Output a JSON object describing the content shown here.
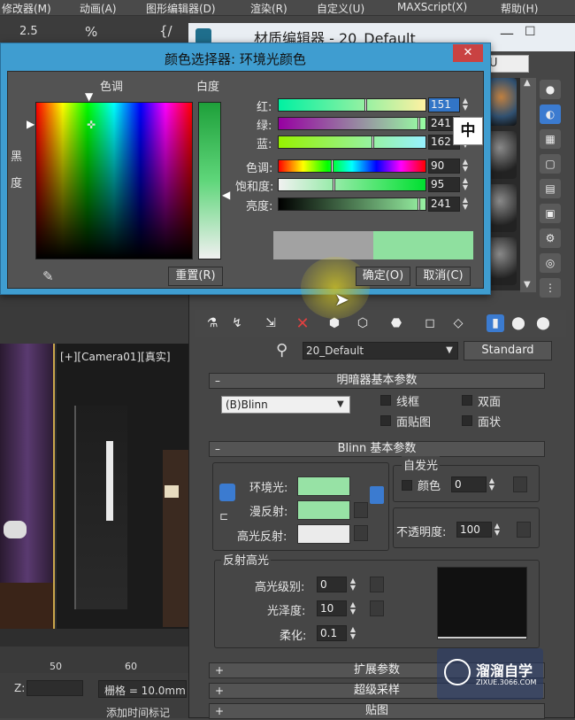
{
  "menubar": {
    "items": [
      "修改器(M)",
      "动画(A)",
      "图形编辑器(D)",
      "渲染(R)",
      "自定义(U)",
      "MAXScript(X)",
      "帮助(H)"
    ]
  },
  "left_toolbar": {
    "snap_value": "2.5",
    "percent": "%"
  },
  "viewport": {
    "camera_label": "[+][Camera01][真实]",
    "ruler_ticks": [
      "50",
      "60"
    ],
    "z_label": "Z:",
    "grid_label": "栅格 = 10.0mm",
    "add_time_tag": "添加时间标记"
  },
  "material_editor": {
    "title": "材质编辑器 - 20_Default",
    "material_name": "20_Default",
    "material_type": "Standard",
    "side_letter": "U",
    "shader_rollout": {
      "title": "明暗器基本参数",
      "shader": "(B)Blinn",
      "wire_label": "线框",
      "two_sided_label": "双面",
      "face_map_label": "面贴图",
      "faceted_label": "面状"
    },
    "blinn_rollout": {
      "title": "Blinn 基本参数",
      "ambient_label": "环境光:",
      "diffuse_label": "漫反射:",
      "specular_label": "高光反射:",
      "self_illum_title": "自发光",
      "color_label": "颜色",
      "self_illum_value": "0",
      "opacity_label": "不透明度:",
      "opacity_value": "100",
      "spec_highlights_title": "反射高光",
      "spec_level_label": "高光级别:",
      "spec_level_value": "0",
      "glossiness_label": "光泽度:",
      "glossiness_value": "10",
      "soften_label": "柔化:",
      "soften_value": "0.1"
    },
    "extra_rollouts": [
      "扩展参数",
      "超级采样",
      "贴图"
    ],
    "swatch_colors": {
      "ambient": "#97e2a5",
      "diffuse": "#97e2a5",
      "specular": "#ebebeb"
    }
  },
  "color_picker": {
    "title": "颜色选择器: 环境光颜色",
    "hue_label": "色调",
    "whiteness_label": "白度",
    "blackness_label": "黑度",
    "red_label": "红:",
    "green_label": "绿:",
    "blue_label": "蓝:",
    "hue_slider_label": "色调:",
    "sat_label": "饱和度:",
    "bright_label": "亮度:",
    "red": "151",
    "green": "241",
    "blue": "162",
    "hue": "90",
    "saturation": "95",
    "brightness": "241",
    "reset_button": "重置(R)",
    "ok_button": "确定(O)",
    "cancel_button": "取消(C)",
    "ime_indicator": "中",
    "new_color": "#97f1a2",
    "old_color": "#a2a2a2"
  },
  "watermark": {
    "brand": "溜溜自学",
    "url": "ZIXUE.3066.COM"
  }
}
